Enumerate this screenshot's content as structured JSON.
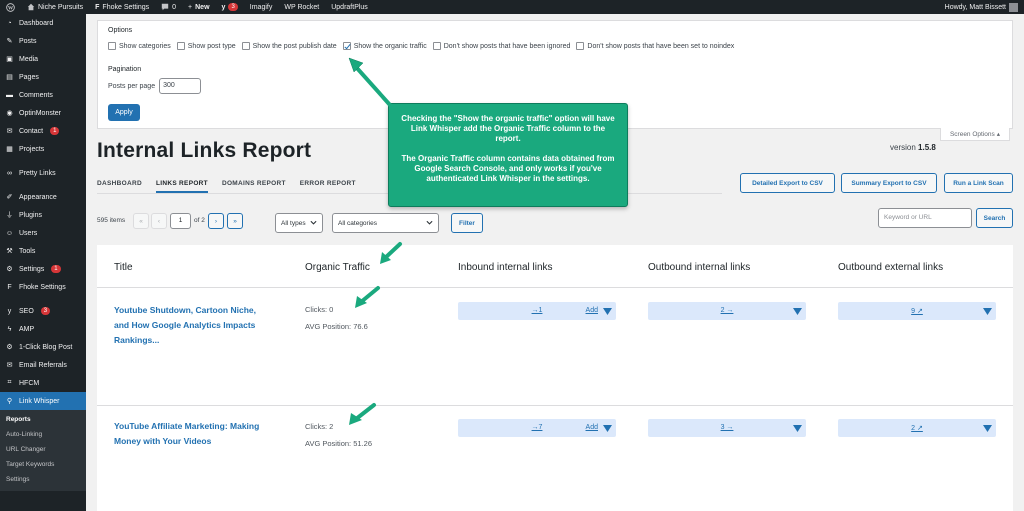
{
  "admin_bar": {
    "site_name": "Niche Pursuits",
    "fhoke_settings": "Fhoke Settings",
    "comments_count": "0",
    "new_label": "New",
    "yoast_badge": "3",
    "imagify": "Imagify",
    "wp_rocket": "WP Rocket",
    "updraftplus": "UpdraftPlus",
    "howdy": "Howdy, Matt Bissett"
  },
  "sidebar": {
    "items": [
      {
        "label": "Dashboard",
        "icon": "dashboard-icon"
      },
      {
        "label": "Posts",
        "icon": "pin-icon"
      },
      {
        "label": "Media",
        "icon": "media-icon"
      },
      {
        "label": "Pages",
        "icon": "pages-icon"
      },
      {
        "label": "Comments",
        "icon": "comment-icon"
      },
      {
        "label": "OptinMonster",
        "icon": "optinmonster-icon"
      },
      {
        "label": "Contact",
        "icon": "mail-icon",
        "badge": "1"
      },
      {
        "label": "Projects",
        "icon": "folder-icon"
      },
      {
        "label": "Pretty Links",
        "icon": "link-icon"
      },
      {
        "label": "Appearance",
        "icon": "brush-icon"
      },
      {
        "label": "Plugins",
        "icon": "plug-icon"
      },
      {
        "label": "Users",
        "icon": "users-icon"
      },
      {
        "label": "Tools",
        "icon": "wrench-icon"
      },
      {
        "label": "Settings",
        "icon": "settings-icon",
        "badge": "1"
      },
      {
        "label": "Fhoke Settings",
        "icon": "fhoke-icon"
      },
      {
        "label": "SEO",
        "icon": "yoast-icon",
        "badge": "3"
      },
      {
        "label": "AMP",
        "icon": "amp-icon"
      },
      {
        "label": "1-Click Blog Post",
        "icon": "gear-icon"
      },
      {
        "label": "Email Referrals",
        "icon": "email-referrals-icon"
      },
      {
        "label": "HFCM",
        "icon": "code-icon"
      },
      {
        "label": "Link Whisper",
        "icon": "link-whisper-icon"
      }
    ],
    "submenu": [
      "Reports",
      "Auto-Linking",
      "URL Changer",
      "Target Keywords",
      "Settings"
    ]
  },
  "screen_options": {
    "options_label": "Options",
    "checkboxes": [
      {
        "label": "Show categories",
        "checked": false
      },
      {
        "label": "Show post type",
        "checked": false
      },
      {
        "label": "Show the post publish date",
        "checked": false
      },
      {
        "label": "Show the organic traffic",
        "checked": true
      },
      {
        "label": "Don't show posts that have been ignored",
        "checked": false
      },
      {
        "label": "Don't show posts that have been set to noindex",
        "checked": false
      }
    ],
    "pagination_label": "Pagination",
    "posts_per_page_label": "Posts per page",
    "posts_per_page_value": "300",
    "apply_label": "Apply",
    "tab_label": "Screen Options"
  },
  "page": {
    "title": "Internal Links Report",
    "version_label": "version",
    "version_number": "1.5.8"
  },
  "nav_tabs": [
    "DASHBOARD",
    "LINKS REPORT",
    "DOMAINS REPORT",
    "ERROR REPORT"
  ],
  "actions": {
    "detailed_export": "Detailed Export to CSV",
    "summary_export": "Summary Export to CSV",
    "link_scan": "Run a Link Scan"
  },
  "filters": {
    "items_count": "595 items",
    "first": "«",
    "prev": "‹",
    "current_page": "1",
    "of_pages": "of 2",
    "next": "›",
    "last": "»",
    "type_select": "All types",
    "category_select": "All categories",
    "filter_button": "Filter",
    "search_placeholder": "Keyword or URL",
    "search_button": "Search"
  },
  "table": {
    "headers": [
      "Title",
      "Organic Traffic",
      "Inbound internal links",
      "Outbound internal links",
      "Outbound external links"
    ],
    "rows": [
      {
        "title_lines": [
          "Youtube Shutdown, Cartoon Niche,",
          "and How Google Analytics Impacts",
          "Rankings..."
        ],
        "clicks": "Clicks: 0",
        "avg_position": "AVG Position: 76.6",
        "inbound": "→1",
        "inbound_add": "Add",
        "outbound_internal": "2 →",
        "outbound_external": "9 ↗"
      },
      {
        "title_lines": [
          "YouTube Affiliate Marketing: Making",
          "Money with Your Videos"
        ],
        "clicks": "Clicks: 2",
        "avg_position": "AVG Position: 51.26",
        "inbound": "→7",
        "inbound_add": "Add",
        "outbound_internal": "3 →",
        "outbound_external": "2 ↗"
      }
    ]
  },
  "callout": {
    "paragraph1": "Checking the \"Show the organic traffic\" option will have Link Whisper add the Organic Traffic column to the report.",
    "paragraph2": "The Organic Traffic column contains data obtained from Google Search Console, and only works if you've authenticated Link Whisper in the settings."
  },
  "colors": {
    "admin_dark": "#1d2327",
    "wp_blue": "#2271b1",
    "callout_green": "#1aa97e",
    "link_box": "#dbe8fb",
    "badge_red": "#d63638"
  }
}
